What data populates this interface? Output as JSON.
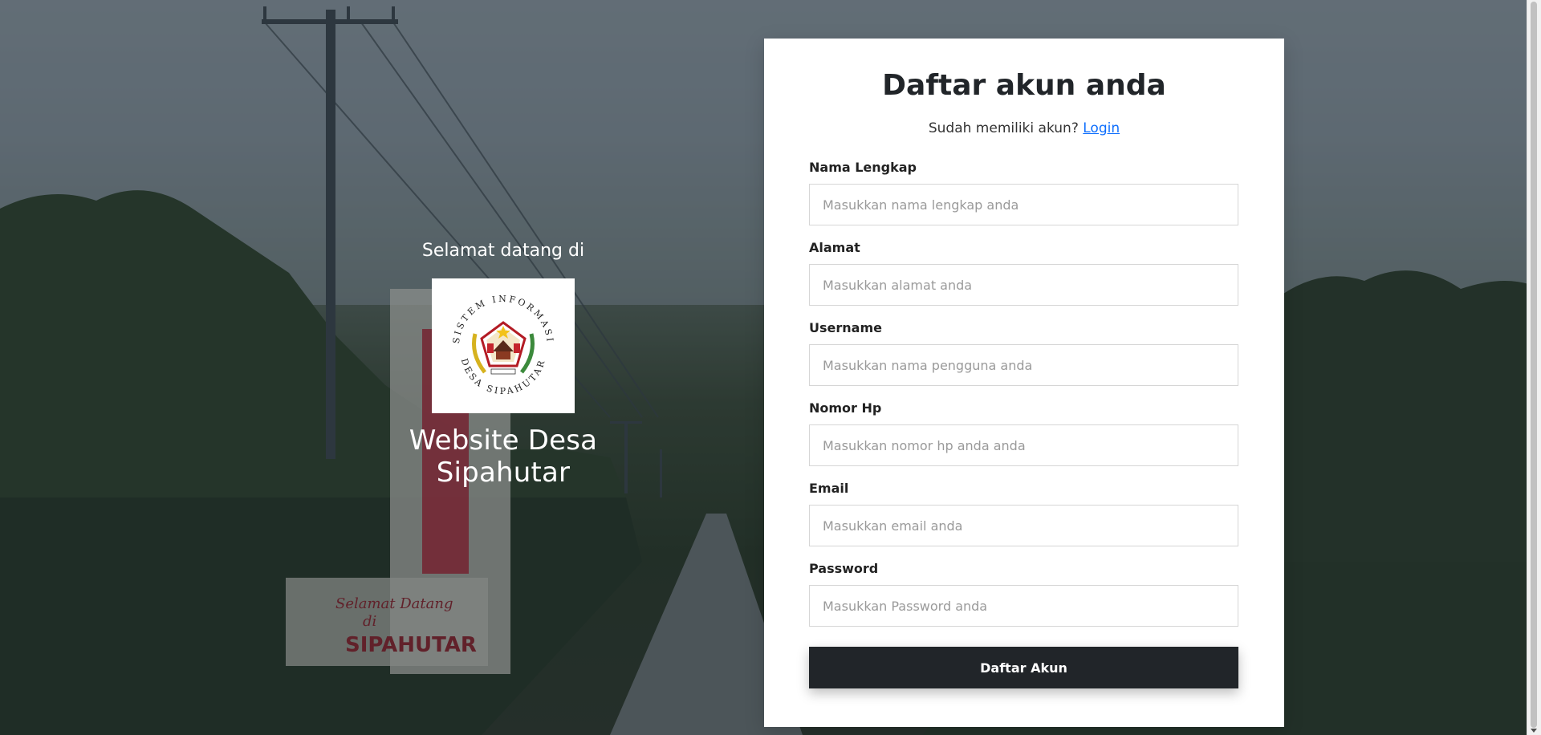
{
  "welcome": {
    "greeting": "Selamat datang di",
    "site_name": "Website Desa Sipahutar",
    "logo": {
      "top_text": "SISTEM INFORMASI",
      "bottom_text": "DESA SIPAHUTAR"
    }
  },
  "form": {
    "title": "Daftar akun anda",
    "subtitle_prefix": "Sudah memiliki akun?",
    "login_link": "Login",
    "fields": [
      {
        "label": "Nama Lengkap",
        "placeholder": "Masukkan nama lengkap anda",
        "value": ""
      },
      {
        "label": "Alamat",
        "placeholder": "Masukkan alamat anda",
        "value": ""
      },
      {
        "label": "Username",
        "placeholder": "Masukkan nama pengguna anda",
        "value": ""
      },
      {
        "label": "Nomor Hp",
        "placeholder": "Masukkan nomor hp anda anda",
        "value": ""
      },
      {
        "label": "Email",
        "placeholder": "Masukkan email anda",
        "value": ""
      },
      {
        "label": "Password",
        "placeholder": "Masukkan Password anda",
        "value": ""
      }
    ],
    "submit_label": "Daftar Akun"
  },
  "colors": {
    "button_bg": "#212529",
    "link": "#0d6efd",
    "card_bg": "#ffffff"
  }
}
